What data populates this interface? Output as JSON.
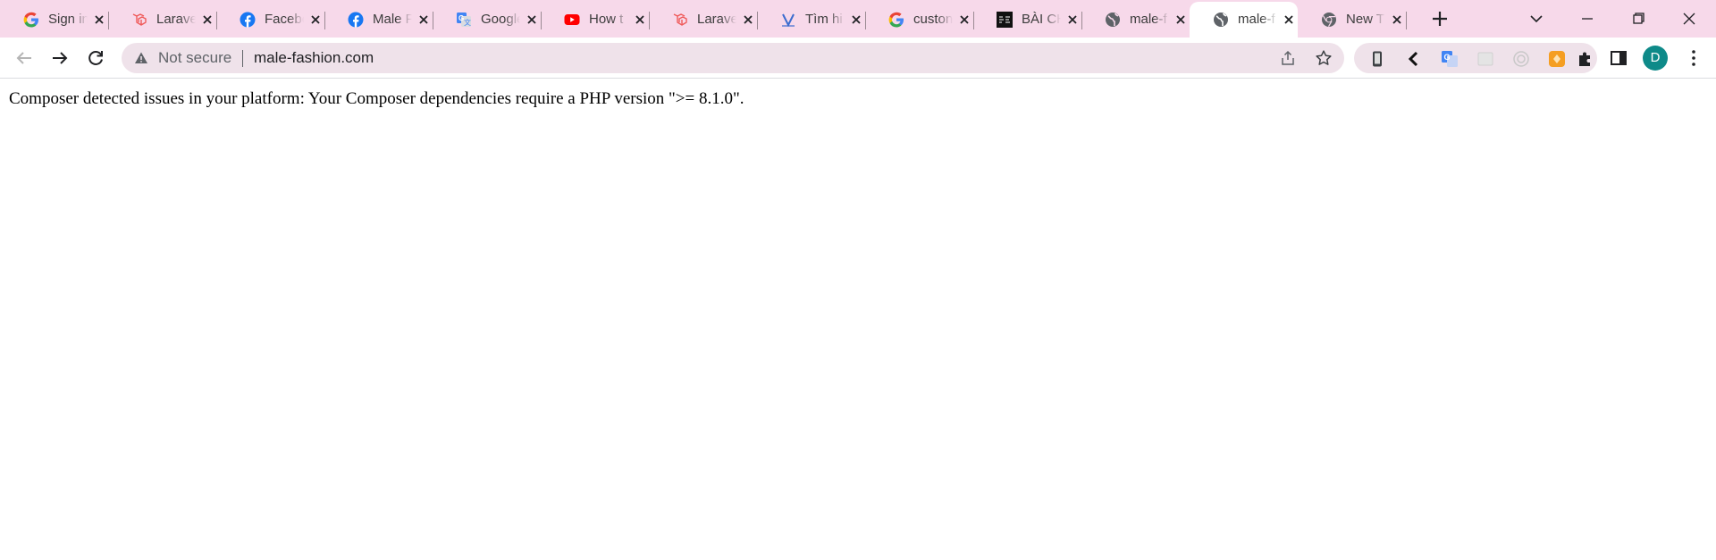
{
  "browser": {
    "tabs": [
      {
        "title": "Sign in",
        "icon": "google-icon",
        "active": false
      },
      {
        "title": "Laravel",
        "icon": "laravel-icon",
        "active": false
      },
      {
        "title": "Facebook",
        "icon": "facebook-icon",
        "active": false
      },
      {
        "title": "Male F",
        "icon": "facebook-icon",
        "active": false
      },
      {
        "title": "Google",
        "icon": "google-translate-icon",
        "active": false
      },
      {
        "title": "How t",
        "icon": "youtube-icon",
        "active": false
      },
      {
        "title": "Laravel",
        "icon": "laravel-icon",
        "active": false
      },
      {
        "title": "Tìm hi",
        "icon": "viblo-icon",
        "active": false
      },
      {
        "title": "custon",
        "icon": "google-icon",
        "active": false
      },
      {
        "title": "BÀI CH",
        "icon": "site-logo-icon",
        "active": false
      },
      {
        "title": "male-f",
        "icon": "globe-icon",
        "active": false
      },
      {
        "title": "male-f",
        "icon": "globe-icon",
        "active": true
      },
      {
        "title": "New T",
        "icon": "chrome-icon",
        "active": false
      }
    ],
    "omnibox": {
      "security_label": "Not secure",
      "url": "male-fashion.com"
    },
    "profile_initial": "D",
    "colors": {
      "tabstrip": "#f7d9ea",
      "omnibox": "#efe2ea",
      "avatar": "#0e8a89"
    }
  },
  "page": {
    "message": "Composer detected issues in your platform: Your Composer dependencies require a PHP version \">= 8.1.0\"."
  }
}
